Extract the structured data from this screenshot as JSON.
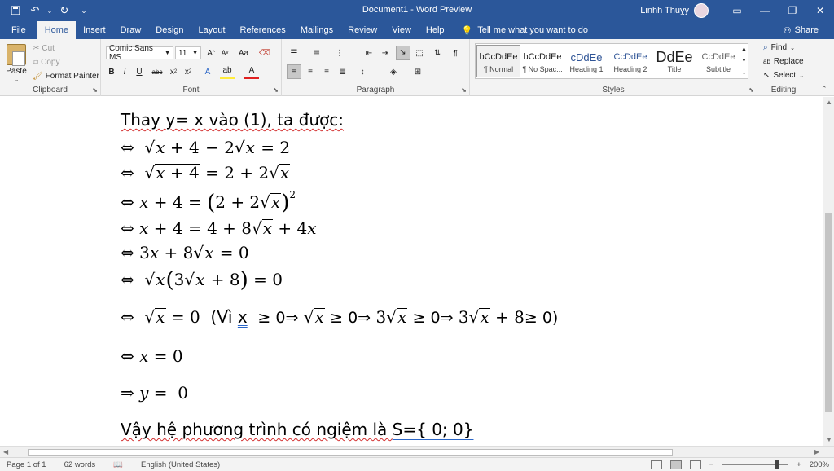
{
  "titlebar": {
    "title": "Document1 - Word Preview",
    "user": "Linhh Thuỵy",
    "qat": [
      "save-icon",
      "undo-icon",
      "redo-icon",
      "customize-icon"
    ]
  },
  "tabs": [
    "File",
    "Home",
    "Insert",
    "Draw",
    "Design",
    "Layout",
    "References",
    "Mailings",
    "Review",
    "View",
    "Help"
  ],
  "active_tab": "Home",
  "tell_me": "Tell me what you want to do",
  "share": "Share",
  "clipboard": {
    "label": "Clipboard",
    "paste": "Paste",
    "cut": "Cut",
    "copy": "Copy",
    "format_painter": "Format Painter"
  },
  "font": {
    "label": "Font",
    "family": "Comic Sans MS",
    "size": "11"
  },
  "paragraph": {
    "label": "Paragraph"
  },
  "styles": {
    "label": "Styles",
    "items": [
      {
        "sample": "bCcDdEe",
        "name": "¶ Normal"
      },
      {
        "sample": "bCcDdEe",
        "name": "¶ No Spac..."
      },
      {
        "sample": "cDdEe",
        "name": "Heading 1"
      },
      {
        "sample": "CcDdEe",
        "name": "Heading 2"
      },
      {
        "sample": "DdEe",
        "name": "Title"
      },
      {
        "sample": "CcDdEe",
        "name": "Subtitle"
      }
    ]
  },
  "editing": {
    "label": "Editing",
    "find": "Find",
    "replace": "Replace",
    "select": "Select"
  },
  "document": {
    "line1": "Thay y= x vào (1), ta được:",
    "last_line_prefix": "Vậy hệ phương trình có ngiệm là ",
    "last_line_set": "S={ 0; 0}",
    "vi_text": "(Vì",
    "vi_x": "x",
    "ge_zero": "≥ 0"
  },
  "status": {
    "page": "Page 1 of 1",
    "words": "62 words",
    "language": "English (United States)",
    "zoom": "200%"
  },
  "colors": {
    "brand": "#2b579a",
    "ribbon_bg": "#f3f3f3"
  }
}
